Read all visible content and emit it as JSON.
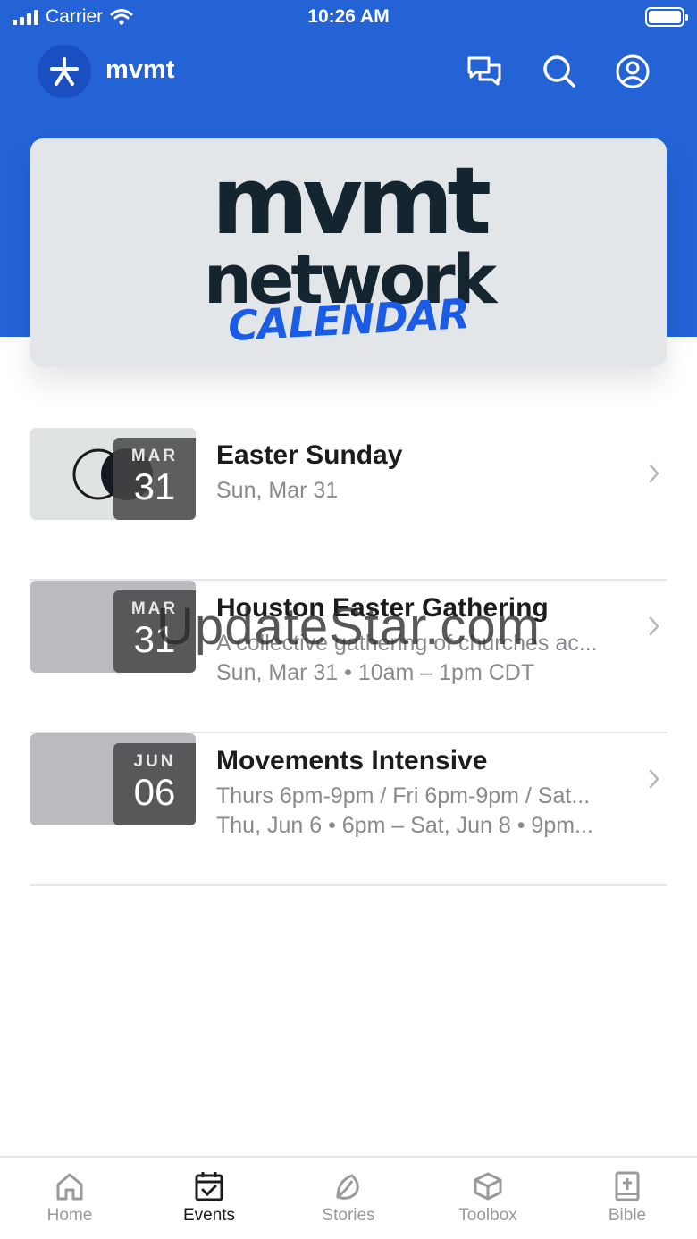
{
  "status_bar": {
    "carrier": "Carrier",
    "time": "10:26 AM"
  },
  "header": {
    "app_name": "mvmt"
  },
  "banner": {
    "line1": "mvmt",
    "line2": "network",
    "line3": "CALENDAR"
  },
  "events": [
    {
      "month": "MAR",
      "day": "31",
      "title": "Easter Sunday",
      "subtitle1": "Sun, Mar 31",
      "subtitle2": ""
    },
    {
      "month": "MAR",
      "day": "31",
      "title": "Houston Easter Gathering",
      "subtitle1": "A collective gathering of churches ac...",
      "subtitle2": "Sun, Mar 31 • 10am – 1pm CDT"
    },
    {
      "month": "JUN",
      "day": "06",
      "title": "Movements Intensive",
      "subtitle1": "Thurs 6pm-9pm / Fri 6pm-9pm / Sat...",
      "subtitle2": "Thu, Jun 6 • 6pm – Sat, Jun 8 • 9pm..."
    }
  ],
  "watermark": "UpdateStar.com",
  "tabs": [
    {
      "label": "Home",
      "icon": "home-icon"
    },
    {
      "label": "Events",
      "icon": "calendar-check-icon",
      "active": true
    },
    {
      "label": "Stories",
      "icon": "leaf-icon"
    },
    {
      "label": "Toolbox",
      "icon": "box-icon"
    },
    {
      "label": "Bible",
      "icon": "bible-icon"
    }
  ],
  "colors": {
    "header": "#2463d6",
    "accent": "#1a5ce6",
    "banner_bg": "#e3e6e9",
    "banner_text": "#14252f"
  }
}
